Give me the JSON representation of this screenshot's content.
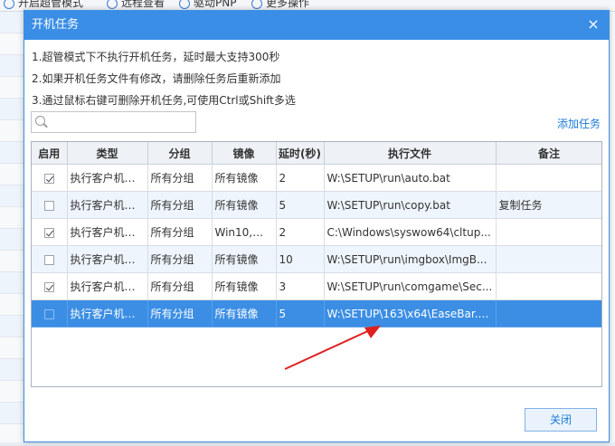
{
  "background_toolbar": {
    "items": [
      {
        "label": "开启超管模式",
        "icon": "person-icon"
      },
      {
        "label": "远程查看",
        "icon": "monitor-icon"
      },
      {
        "label": "驱动PNP",
        "icon": "gear-icon"
      },
      {
        "label": "更多操作",
        "icon": "more-icon"
      }
    ]
  },
  "dialog": {
    "title": "开机任务",
    "close_icon": "×",
    "notes": [
      "1.超管模式下不执行开机任务，延时最大支持300秒",
      "2.如果开机任务文件有修改，请删除任务后重新添加",
      "3.通过鼠标右键可删除开机任务,可使用Ctrl或Shift多选"
    ],
    "search": {
      "placeholder": "",
      "value": ""
    },
    "add_task_label": "添加任务",
    "close_button_label": "关闭"
  },
  "table": {
    "headers": [
      "启用",
      "类型",
      "分组",
      "镜像",
      "延时(秒)",
      "执行文件",
      "备注"
    ],
    "rows": [
      {
        "enabled": true,
        "type": "执行客户机程...",
        "group": "所有分组",
        "image": "所有镜像",
        "delay": "2",
        "file": "W:\\SETUP\\run\\auto.bat",
        "note": ""
      },
      {
        "enabled": false,
        "type": "执行客户机程...",
        "group": "所有分组",
        "image": "所有镜像",
        "delay": "5",
        "file": "W:\\SETUP\\run\\copy.bat",
        "note": "复制任务"
      },
      {
        "enabled": true,
        "type": "执行客户机程...",
        "group": "所有分组",
        "image": "Win10,会...",
        "delay": "2",
        "file": "C:\\Windows\\syswow64\\cltup...",
        "note": ""
      },
      {
        "enabled": false,
        "type": "执行客户机程...",
        "group": "所有分组",
        "image": "所有镜像",
        "delay": "10",
        "file": "W:\\SETUP\\run\\imgbox\\ImgB...",
        "note": ""
      },
      {
        "enabled": true,
        "type": "执行客户机程...",
        "group": "所有分组",
        "image": "所有镜像",
        "delay": "3",
        "file": "W:\\SETUP\\run\\comgame\\Sec...",
        "note": ""
      },
      {
        "enabled": false,
        "type": "执行客户机程...",
        "group": "所有分组",
        "image": "所有镜像",
        "delay": "5",
        "file": "W:\\SETUP\\163\\x64\\EaseBar.exe",
        "note": "",
        "selected": true
      }
    ]
  },
  "colors": {
    "titlebar": "#3a8ee6",
    "selected_row": "#3b8ee4",
    "link": "#1a7ad8",
    "arrow": "#e02020"
  }
}
